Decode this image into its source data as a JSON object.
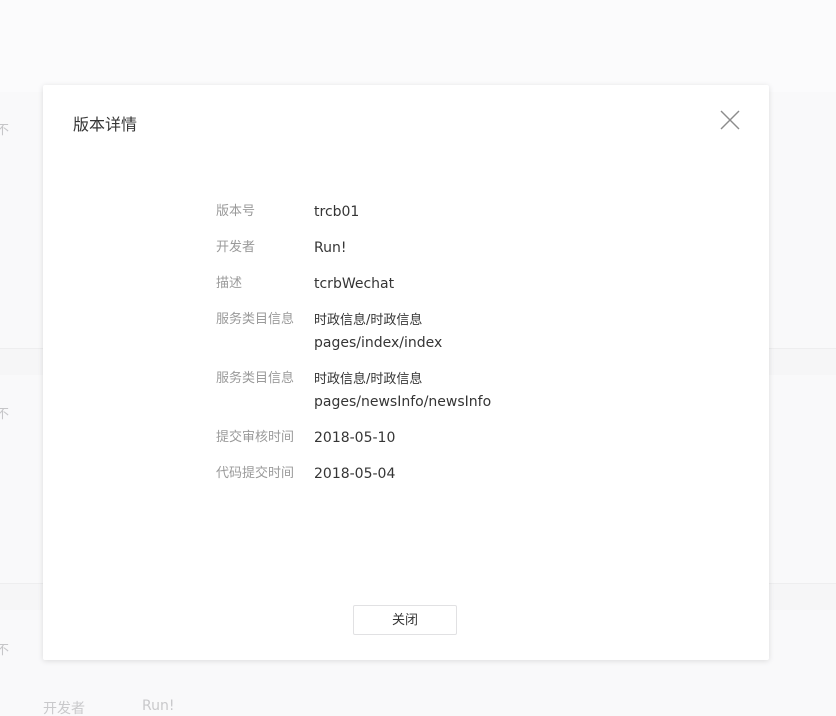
{
  "background": {
    "fragment_glyph": "不",
    "bottom_label": "开发者",
    "bottom_value": "Run!"
  },
  "dialog": {
    "title": "版本详情",
    "close_icon": "close-x-icon",
    "rows": {
      "version": {
        "label": "版本号",
        "value": "trcb01"
      },
      "developer": {
        "label": "开发者",
        "value": "Run!"
      },
      "description": {
        "label": "描述",
        "value": "tcrbWechat"
      },
      "service1": {
        "label": "服务类目信息",
        "category": "时政信息/时政信息",
        "path": "pages/index/index"
      },
      "service2": {
        "label": "服务类目信息",
        "category": "时政信息/时政信息",
        "path": "pages/newsInfo/newsInfo"
      },
      "submit_time": {
        "label": "提交审核时间",
        "value": "2018-05-10"
      },
      "code_time": {
        "label": "代码提交时间",
        "value": "2018-05-04"
      }
    },
    "close_button_label": "关闭"
  }
}
